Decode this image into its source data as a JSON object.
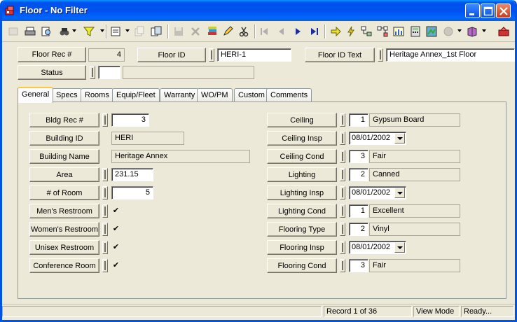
{
  "window": {
    "title": "Floor - No Filter"
  },
  "header": {
    "floor_rec_label": "Floor Rec #",
    "floor_rec_value": "4",
    "floor_id_label": "Floor ID",
    "floor_id_value": "HERI-1",
    "floor_id_text_label": "Floor ID Text",
    "floor_id_text_value": "Heritage Annex_1st Floor",
    "status_label": "Status",
    "status_value": "",
    "status_text": ""
  },
  "tabs": [
    "General",
    "Specs",
    "Rooms",
    "Equip/Fleet",
    "Warranty",
    "WO/PM",
    "Custom",
    "Comments"
  ],
  "left": {
    "bldg_rec_label": "Bldg Rec #",
    "bldg_rec_value": "3",
    "building_id_label": "Building ID",
    "building_id_value": "HERI",
    "building_name_label": "Building Name",
    "building_name_value": "Heritage Annex",
    "area_label": "Area",
    "area_value": "231.15",
    "rooms_label": "# of Room",
    "rooms_value": "5",
    "mens_label": "Men's Restroom",
    "womens_label": "Women's Restroom",
    "unisex_label": "Unisex Restroom",
    "conference_label": "Conference Room",
    "checkmark": "✔"
  },
  "right": {
    "ceiling_label": "Ceiling",
    "ceiling_code": "1",
    "ceiling_text": "Gypsum Board",
    "ceiling_insp_label": "Ceiling Insp",
    "ceiling_insp_value": "08/01/2002",
    "ceiling_cond_label": "Ceiling Cond",
    "ceiling_cond_code": "3",
    "ceiling_cond_text": "Fair",
    "lighting_label": "Lighting",
    "lighting_code": "2",
    "lighting_text": "Canned",
    "lighting_insp_label": "Lighting Insp",
    "lighting_insp_value": "08/01/2002",
    "lighting_cond_label": "Lighting Cond",
    "lighting_cond_code": "1",
    "lighting_cond_text": "Excellent",
    "flooring_type_label": "Flooring Type",
    "flooring_type_code": "2",
    "flooring_type_text": "Vinyl",
    "flooring_insp_label": "Flooring Insp",
    "flooring_insp_value": "08/01/2002",
    "flooring_cond_label": "Flooring Cond",
    "flooring_cond_code": "3",
    "flooring_cond_text": "Fair"
  },
  "status_bar": {
    "record": "Record 1 of 36",
    "mode": "View Mode",
    "state": "Ready..."
  },
  "colors": {
    "titlebar": "#0054e3",
    "face": "#ece9d8",
    "tab_highlight": "#ffc83c"
  }
}
